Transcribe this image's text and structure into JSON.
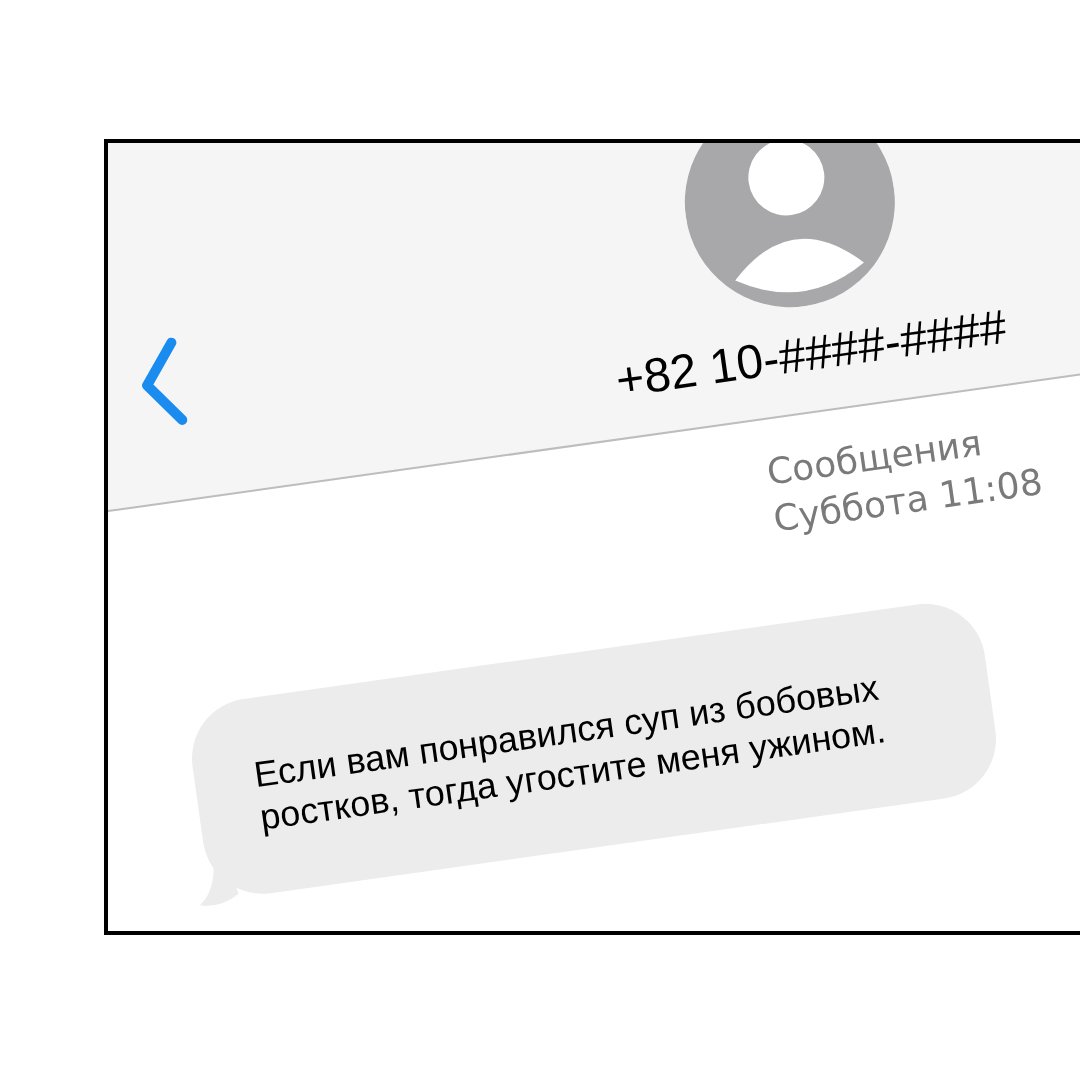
{
  "header": {
    "contact": "+82 10-####-####"
  },
  "meta": {
    "app": "Сообщения",
    "time": "Суббота 11:08"
  },
  "messages": [
    {
      "text": "Если вам понравился суп из бобовых ростков, тогда угостите меня ужином."
    }
  ]
}
